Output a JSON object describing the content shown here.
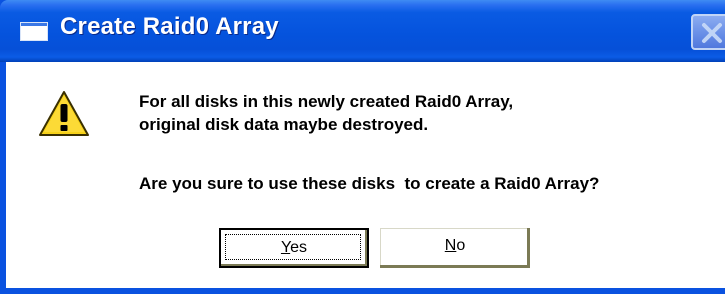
{
  "dialog": {
    "title": "Create Raid0 Array",
    "message_line1": "For all disks in this newly created Raid0 Array,",
    "message_line2": "original disk data maybe destroyed.",
    "question": "Are you sure to use these disks  to create a Raid0 Array?",
    "buttons": {
      "yes_label": "Yes",
      "yes_accesskey": "Y",
      "yes_rest": "es",
      "no_label": "No",
      "no_accesskey": "N",
      "no_rest": "o"
    }
  },
  "icons": {
    "window_icon": "window-icon",
    "close": "close-icon",
    "warning": "warning-icon"
  },
  "colors": {
    "titlebar": "#0553dd",
    "client_background": "#ffffff",
    "warning_fill": "#f7d21a",
    "button_shadow": "#7b7a55"
  }
}
